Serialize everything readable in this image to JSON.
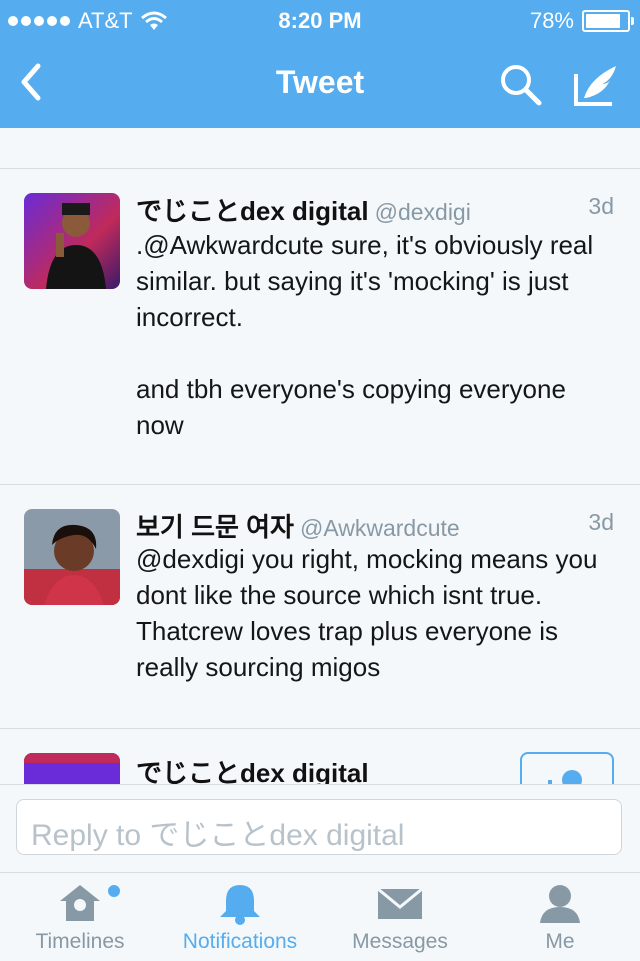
{
  "status_bar": {
    "carrier": "AT&T",
    "time": "8:20 PM",
    "battery": "78%",
    "battery_level": 0.78
  },
  "nav": {
    "title": "Tweet",
    "back_icon": "chevron-left-icon",
    "search_icon": "search-icon",
    "compose_icon": "compose-icon"
  },
  "tweets": [
    {
      "name": "でじことdex digital",
      "handle": "@dexdigi",
      "age": "3d",
      "text": ".@Awkwardcute sure, it's obviously real similar. but saying it's 'mocking' is just incorrect.\n\nand tbh everyone's copying everyone now"
    },
    {
      "name": "보기 드문 여자",
      "handle": "@Awkwardcute",
      "age": "3d",
      "text": "@dexdigi you right, mocking means you dont like the source which isnt true. Thatcrew loves trap plus everyone is really sourcing migos"
    },
    {
      "name": "でじことdex digital"
    }
  ],
  "reply": {
    "placeholder": "Reply to でじことdex digital"
  },
  "tabs": [
    {
      "label": "Timelines",
      "icon": "home-icon"
    },
    {
      "label": "Notifications",
      "icon": "bell-icon"
    },
    {
      "label": "Messages",
      "icon": "envelope-icon"
    },
    {
      "label": "Me",
      "icon": "person-icon"
    }
  ],
  "colors": {
    "brand": "#55acee",
    "muted": "#8899a6",
    "text": "#14171a"
  }
}
